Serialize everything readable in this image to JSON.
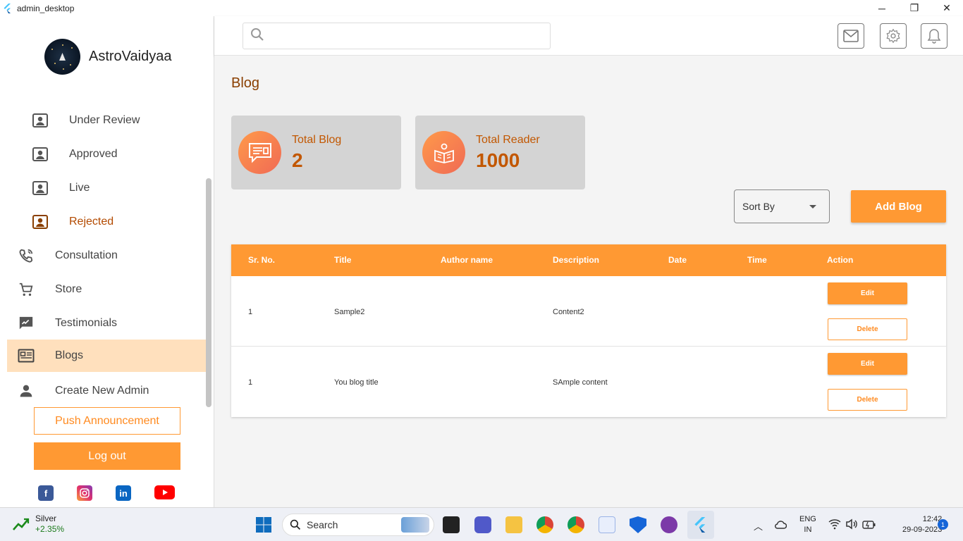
{
  "window": {
    "title": "admin_desktop",
    "minimize": "─",
    "maximize": "❐",
    "close": "✕"
  },
  "brand": {
    "name": "AstroVaidyaa"
  },
  "sidebar": {
    "items": [
      {
        "label": "Under Review"
      },
      {
        "label": "Approved"
      },
      {
        "label": "Live"
      },
      {
        "label": "Rejected"
      },
      {
        "label": "Consultation"
      },
      {
        "label": "Store"
      },
      {
        "label": "Testimonials"
      },
      {
        "label": "Blogs"
      },
      {
        "label": "Create New Admin"
      }
    ],
    "push_label": "Push Announcement",
    "logout_label": "Log out"
  },
  "main": {
    "title": "Blog",
    "stats": [
      {
        "label": "Total Blog",
        "value": "2"
      },
      {
        "label": "Total Reader",
        "value": "1000"
      }
    ],
    "sort_label": "Sort By",
    "add_label": "Add Blog"
  },
  "table": {
    "headers": [
      "Sr. No.",
      "Title",
      "Author name",
      "Description",
      "Date",
      "Time",
      "Action"
    ],
    "rows": [
      {
        "sr": "1",
        "title": "Sample2",
        "author": "",
        "description": "Content2",
        "date": "",
        "time": ""
      },
      {
        "sr": "1",
        "title": "You blog title",
        "author": "",
        "description": "SAmple content",
        "date": "",
        "time": ""
      }
    ],
    "edit_label": "Edit",
    "delete_label": "Delete"
  },
  "taskbar": {
    "weather_name": "Silver",
    "weather_change": "+2.35%",
    "search_label": "Search",
    "lang": "ENG",
    "region": "IN",
    "time": "12:42",
    "date": "29-09-2023",
    "notification_count": "1"
  },
  "colors": {
    "accent": "#ff9933",
    "active_bg": "#ffe0bd",
    "title": "#8a3f00"
  }
}
